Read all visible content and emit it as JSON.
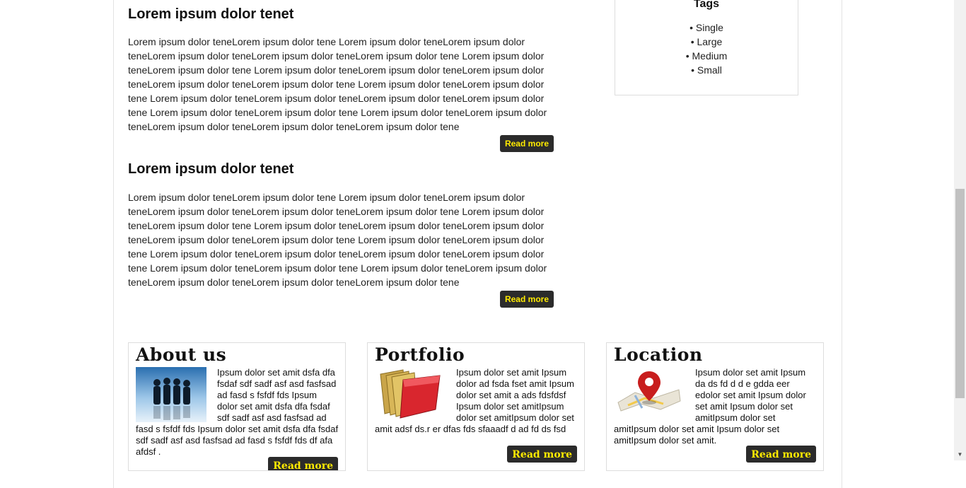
{
  "articles": [
    {
      "title": "Lorem ipsum dolor tenet",
      "body": "Lorem ipsum dolor teneLorem ipsum dolor tene Lorem ipsum dolor teneLorem ipsum dolor teneLorem ipsum dolor teneLorem ipsum dolor teneLorem ipsum dolor tene Lorem ipsum dolor teneLorem ipsum dolor tene Lorem ipsum dolor teneLorem ipsum dolor teneLorem ipsum dolor teneLorem ipsum dolor teneLorem ipsum dolor tene Lorem ipsum dolor teneLorem ipsum dolor tene Lorem ipsum dolor teneLorem ipsum dolor teneLorem ipsum dolor teneLorem ipsum dolor tene Lorem ipsum dolor teneLorem ipsum dolor tene Lorem ipsum dolor teneLorem ipsum dolor teneLorem ipsum dolor teneLorem ipsum dolor teneLorem ipsum dolor tene",
      "read_more": "Read more"
    },
    {
      "title": "Lorem ipsum dolor tenet",
      "body": "Lorem ipsum dolor teneLorem ipsum dolor tene Lorem ipsum dolor teneLorem ipsum dolor teneLorem ipsum dolor teneLorem ipsum dolor teneLorem ipsum dolor tene Lorem ipsum dolor teneLorem ipsum dolor tene Lorem ipsum dolor teneLorem ipsum dolor teneLorem ipsum dolor teneLorem ipsum dolor teneLorem ipsum dolor tene Lorem ipsum dolor teneLorem ipsum dolor tene Lorem ipsum dolor teneLorem ipsum dolor teneLorem ipsum dolor teneLorem ipsum dolor tene Lorem ipsum dolor teneLorem ipsum dolor tene Lorem ipsum dolor teneLorem ipsum dolor teneLorem ipsum dolor teneLorem ipsum dolor teneLorem ipsum dolor tene",
      "read_more": "Read more"
    }
  ],
  "tags": {
    "title": "Tags",
    "items": [
      "• Single",
      "• Large",
      "• Medium",
      "• Small"
    ]
  },
  "boxes": [
    {
      "title": "About us",
      "icon": "people-silhouette-icon",
      "text": "Ipsum dolor set amit dsfa dfa fsdaf sdf sadf asf asd fasfsad ad fasd s fsfdf fds Ipsum dolor set amit dsfa dfa fsdaf sdf sadf asf asd fasfsad ad fasd s fsfdf fds Ipsum dolor set amit dsfa dfa fsdaf sdf sadf asf asd fasfsad ad fasd s fsfdf fds df afa afdsf .",
      "read_more": "Read more"
    },
    {
      "title": "Portfolio",
      "icon": "folders-icon",
      "text": "Ipsum dolor set amit Ipsum dolor ad fsda fset amit Ipsum dolor set amit a ads fdsfdsf Ipsum dolor set amitIpsum dolor set amitIpsum dolor set amit adsf ds.r er dfas fds sfaaadf d ad fd ds fsd",
      "read_more": "Read more"
    },
    {
      "title": "Location",
      "icon": "map-pin-icon",
      "text": "Ipsum dolor set amit Ipsum da ds fd d d e gdda eer edolor set amit Ipsum dolor set amit Ipsum dolor set amitIpsum dolor set amitIpsum dolor set amit Ipsum dolor set amitIpsum dolor set amit.",
      "read_more": "Read more"
    }
  ],
  "colors": {
    "button_bg": "#2b2b2b",
    "button_text": "#ffea00"
  }
}
